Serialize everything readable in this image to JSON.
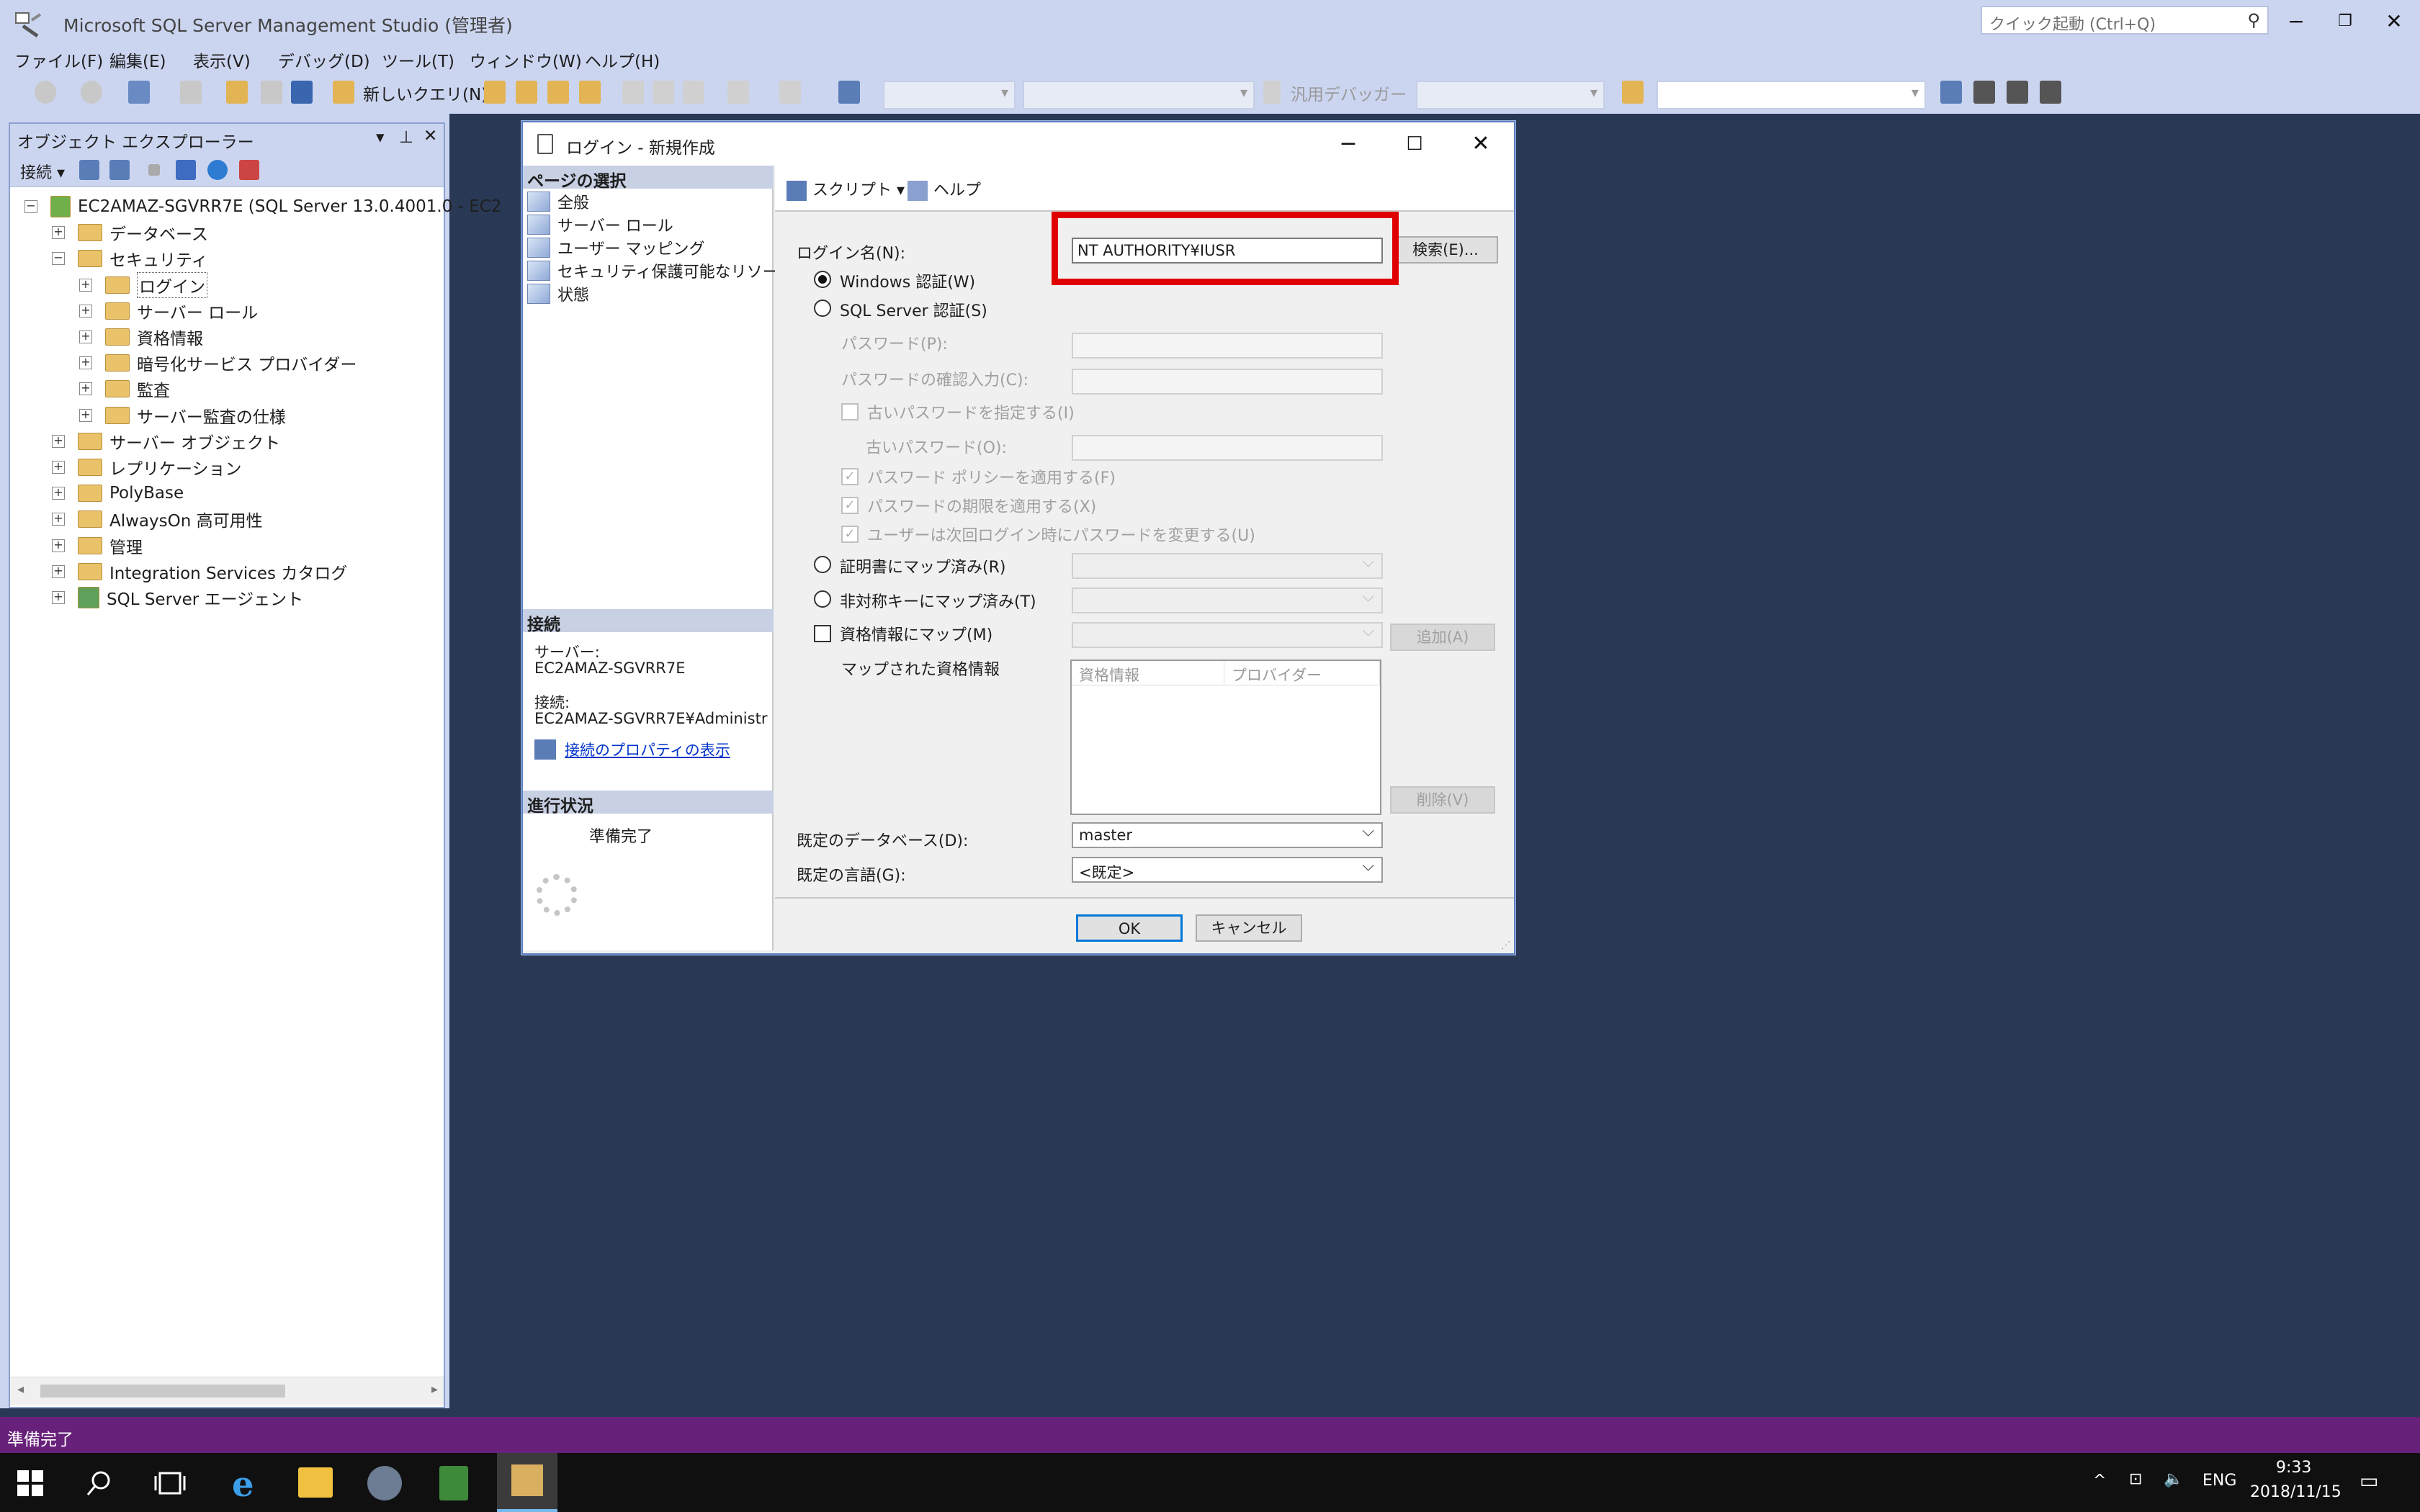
{
  "window": {
    "title": "Microsoft SQL Server Management Studio (管理者)",
    "quick_launch_placeholder": "クイック起動 (Ctrl+Q)"
  },
  "menu": [
    "ファイル(F)",
    "編集(E)",
    "表示(V)",
    "デバッグ(D)",
    "ツール(T)",
    "ウィンドウ(W)",
    "ヘルプ(H)"
  ],
  "toolbar": {
    "new_query_label": "新しいクエリ(N)",
    "debugger_label": "汎用デバッガー"
  },
  "object_explorer": {
    "title": "オブジェクト エクスプローラー",
    "connect_label": "接続",
    "tree": [
      {
        "label": "EC2AMAZ-SGVRR7E (SQL Server 13.0.4001.0 - EC2",
        "level": 0,
        "exp": "−",
        "kind": "server"
      },
      {
        "label": "データベース",
        "level": 1,
        "exp": "+",
        "kind": "folder"
      },
      {
        "label": "セキュリティ",
        "level": 1,
        "exp": "−",
        "kind": "folder"
      },
      {
        "label": "ログイン",
        "level": 2,
        "exp": "+",
        "kind": "folder",
        "selected": true
      },
      {
        "label": "サーバー ロール",
        "level": 2,
        "exp": "+",
        "kind": "folder"
      },
      {
        "label": "資格情報",
        "level": 2,
        "exp": "+",
        "kind": "folder"
      },
      {
        "label": "暗号化サービス プロバイダー",
        "level": 2,
        "exp": "+",
        "kind": "folder"
      },
      {
        "label": "監査",
        "level": 2,
        "exp": "+",
        "kind": "folder"
      },
      {
        "label": "サーバー監査の仕様",
        "level": 2,
        "exp": "+",
        "kind": "folder"
      },
      {
        "label": "サーバー オブジェクト",
        "level": 1,
        "exp": "+",
        "kind": "folder"
      },
      {
        "label": "レプリケーション",
        "level": 1,
        "exp": "+",
        "kind": "folder"
      },
      {
        "label": "PolyBase",
        "level": 1,
        "exp": "+",
        "kind": "folder"
      },
      {
        "label": "AlwaysOn 高可用性",
        "level": 1,
        "exp": "+",
        "kind": "folder"
      },
      {
        "label": "管理",
        "level": 1,
        "exp": "+",
        "kind": "folder"
      },
      {
        "label": "Integration Services カタログ",
        "level": 1,
        "exp": "+",
        "kind": "folder"
      },
      {
        "label": "SQL Server エージェント",
        "level": 1,
        "exp": "+",
        "kind": "agent"
      }
    ]
  },
  "dialog": {
    "title": "ログイン - 新規作成",
    "page_select_header": "ページの選択",
    "pages": [
      "全般",
      "サーバー ロール",
      "ユーザー マッピング",
      "セキュリティ保護可能なリソース",
      "状態"
    ],
    "connection_header": "接続",
    "server_label": "サーバー:",
    "server_value": "EC2AMAZ-SGVRR7E",
    "connection_label": "接続:",
    "connection_value": "EC2AMAZ-SGVRR7E¥Administr",
    "view_props_link": "接続のプロパティの表示",
    "progress_header": "進行状況",
    "progress_status": "準備完了",
    "script_label": "スクリプト",
    "help_label": "ヘルプ",
    "login_name_label": "ログイン名(N):",
    "login_name_value": "NT AUTHORITY¥IUSR",
    "search_button": "検索(E)...",
    "windows_auth_label": "Windows 認証(W)",
    "sql_auth_label": "SQL Server 認証(S)",
    "password_label": "パスワード(P):",
    "confirm_password_label": "パスワードの確認入力(C):",
    "specify_old_password_label": "古いパスワードを指定する(I)",
    "old_password_label": "古いパスワード(O):",
    "enforce_policy_label": "パスワード ポリシーを適用する(F)",
    "enforce_expiration_label": "パスワードの期限を適用する(X)",
    "must_change_label": "ユーザーは次回ログイン時にパスワードを変更する(U)",
    "cert_map_label": "証明書にマップ済み(R)",
    "asym_key_map_label": "非対称キーにマップ済み(T)",
    "cred_map_label": "資格情報にマップ(M)",
    "add_button": "追加(A)",
    "mapped_creds_label": "マップされた資格情報",
    "grid_headers": [
      "資格情報",
      "プロバイダー"
    ],
    "remove_button": "削除(V)",
    "default_db_label": "既定のデータベース(D):",
    "default_db_value": "master",
    "default_lang_label": "既定の言語(G):",
    "default_lang_value": "<既定>",
    "ok_button": "OK",
    "cancel_button": "キャンセル"
  },
  "status_bar": {
    "text": "準備完了"
  },
  "taskbar": {
    "language": "ENG",
    "time": "9:33",
    "date": "2018/11/15"
  },
  "colors": {
    "highlight": "#e00000",
    "status_bar": "#68217a",
    "workspace": "#293955"
  }
}
